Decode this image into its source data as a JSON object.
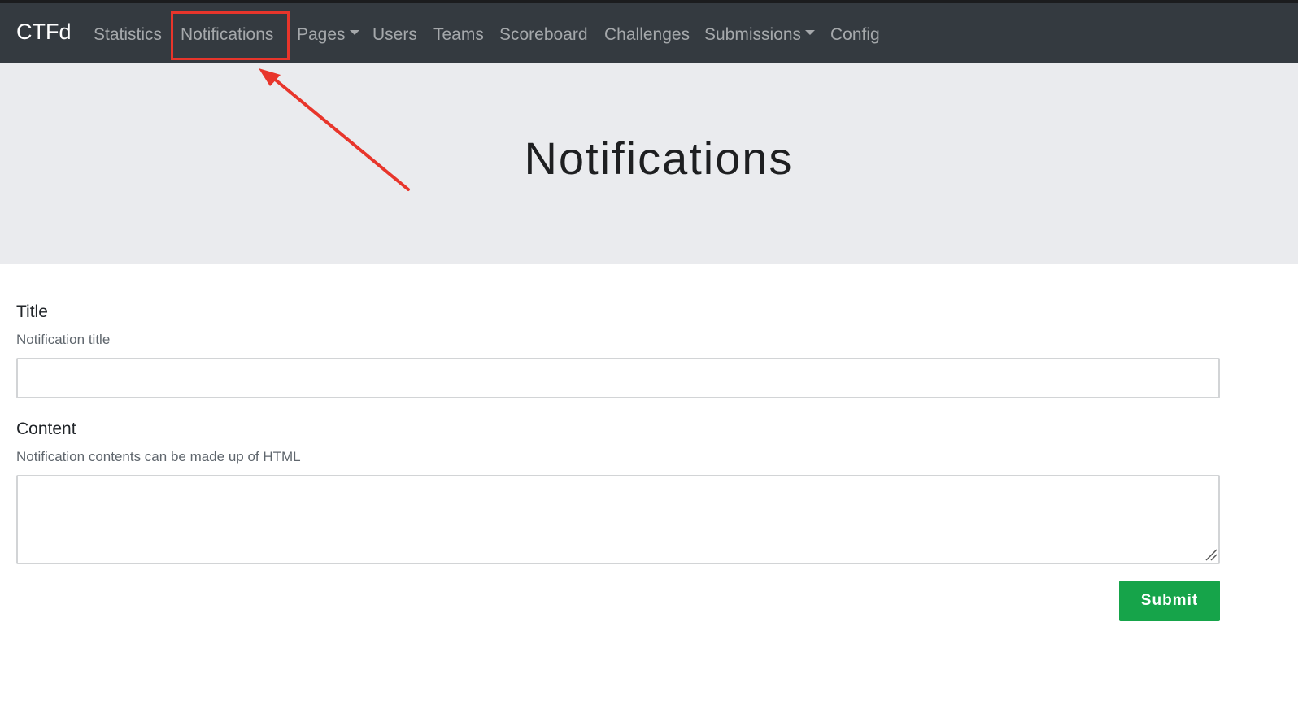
{
  "navbar": {
    "brand": "CTFd",
    "items": [
      {
        "label": "Statistics"
      },
      {
        "label": "Notifications"
      },
      {
        "label": "Pages"
      },
      {
        "label": "Users"
      },
      {
        "label": "Teams"
      },
      {
        "label": "Scoreboard"
      },
      {
        "label": "Challenges"
      },
      {
        "label": "Submissions"
      },
      {
        "label": "Config"
      }
    ]
  },
  "header": {
    "title": "Notifications"
  },
  "form": {
    "title_label": "Title",
    "title_help": "Notification title",
    "title_value": "",
    "content_label": "Content",
    "content_help": "Notification contents can be made up of HTML",
    "content_value": "",
    "submit_label": "Submit"
  },
  "colors": {
    "navbar_bg": "#343a40",
    "highlight": "#e8352b",
    "submit_bg": "#16a44a"
  }
}
